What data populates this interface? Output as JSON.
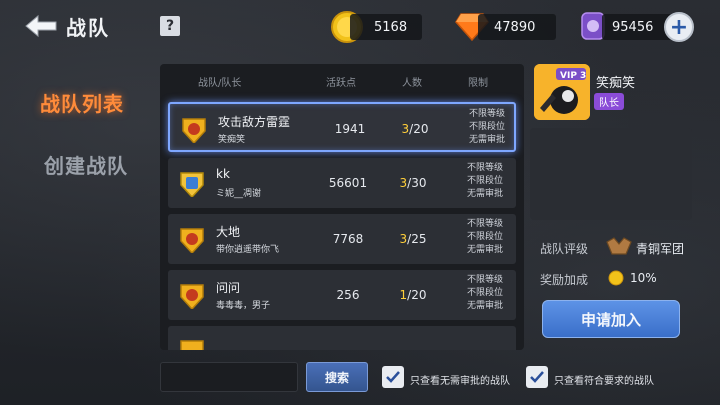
{
  "header": {
    "title": "战队",
    "help": "?",
    "coins": "5168",
    "gems": "47890",
    "orbs": "95456",
    "plus": "+"
  },
  "tabs": {
    "list": "战队列表",
    "create": "创建战队"
  },
  "table": {
    "columns": [
      "战队/队长",
      "活跃点",
      "人数",
      "限制"
    ],
    "rows": [
      {
        "name": "攻击敌方雷霆",
        "leader": "笑痴笑",
        "activity": "1941",
        "cur": "3",
        "max": "/20",
        "limits": [
          "不限等级",
          "不限段位",
          "无需审批"
        ]
      },
      {
        "name": "kk",
        "leader": "ミ妮__凋谢",
        "activity": "56601",
        "cur": "3",
        "max": "/30",
        "limits": [
          "不限等级",
          "不限段位",
          "无需审批"
        ]
      },
      {
        "name": "大地",
        "leader": "带你逍遥带你飞",
        "activity": "7768",
        "cur": "3",
        "max": "/25",
        "limits": [
          "不限等级",
          "不限段位",
          "无需审批"
        ]
      },
      {
        "name": "问问",
        "leader": "毒毒毒，男子",
        "activity": "256",
        "cur": "1",
        "max": "/20",
        "limits": [
          "不限等级",
          "不限段位",
          "无需审批"
        ]
      }
    ]
  },
  "player": {
    "vip": "VIP 3",
    "name": "笑痴笑",
    "role": "队长"
  },
  "team_info": {
    "rank_label": "战队评级",
    "rank_value": "青铜军团",
    "bonus_label": "奖励加成",
    "bonus_value": "10%",
    "join_button": "申请加入"
  },
  "bottom": {
    "search_button": "搜索",
    "filter_no_approval": "只查看无需审批的战队",
    "filter_eligible": "只查看符合要求的战队"
  },
  "colors": {
    "accent_orange": "#ff8b3a",
    "selected_border": "#7ea7ff",
    "count_highlight": "#ffcf3a",
    "join_button": "#4a80d8"
  }
}
